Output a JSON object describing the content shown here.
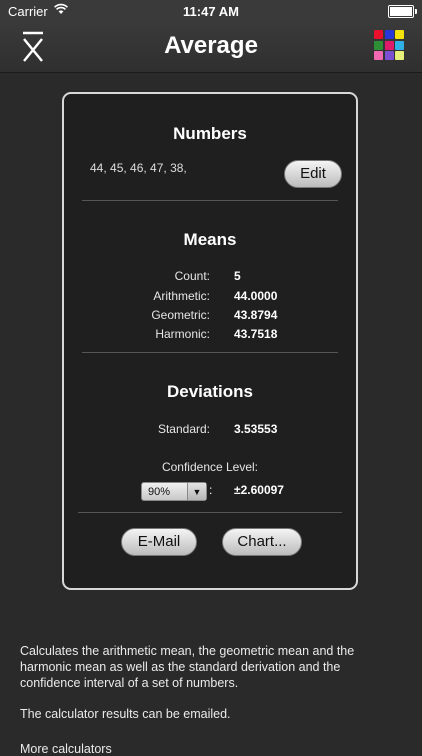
{
  "status_bar": {
    "carrier": "Carrier",
    "time": "11:47 AM"
  },
  "nav": {
    "title": "Average",
    "left_icon": "x-bar-icon",
    "right_icon": "color-grid-icon"
  },
  "colors": {
    "grid": [
      "#e8102a",
      "#2a37d8",
      "#f3e20c",
      "#2e8e35",
      "#e01a6a",
      "#2fb0e6",
      "#f06ab3",
      "#7d4fd2",
      "#e8f07c"
    ]
  },
  "numbers": {
    "title": "Numbers",
    "list": "44, 45, 46, 47, 38,",
    "edit_label": "Edit"
  },
  "means": {
    "title": "Means",
    "rows": [
      {
        "label": "Count:",
        "value": "5"
      },
      {
        "label": "Arithmetic:",
        "value": "44.0000"
      },
      {
        "label": "Geometric:",
        "value": "43.8794"
      },
      {
        "label": "Harmonic:",
        "value": "43.7518"
      }
    ]
  },
  "deviations": {
    "title": "Deviations",
    "standard_label": "Standard:",
    "standard_value": "3.53553",
    "confidence_label": "Confidence Level:",
    "confidence_selected": "90%",
    "colon": ":",
    "confidence_value": "±2.60097"
  },
  "actions": {
    "email_label": "E-Mail",
    "chart_label": "Chart..."
  },
  "description": {
    "p1": "Calculates the arithmetic mean, the geometric mean and the harmonic mean as well as the standard derivation and the confidence interval of a set of numbers.",
    "p2": "The calculator results can be emailed.",
    "more": "More calculators"
  }
}
